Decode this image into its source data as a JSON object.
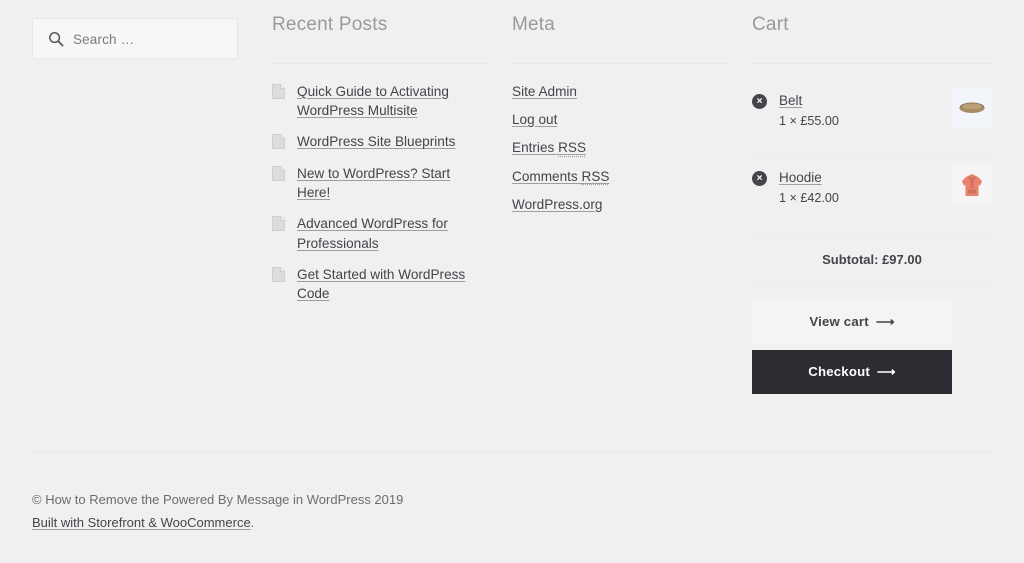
{
  "theme": {
    "page_bg": "#f0f0f0",
    "text_color": "#43454b",
    "muted_color": "#9a9a9a",
    "divider_color": "#e7e7e7",
    "checkout_bg": "#2c2d33",
    "view_cart_bg": "#f4f4f4"
  },
  "search": {
    "placeholder": "Search …",
    "value": "",
    "icon": "search-icon"
  },
  "recent_posts": {
    "title": "Recent Posts",
    "items": [
      {
        "label": "Quick Guide to Activating WordPress Multisite",
        "icon": "document-icon"
      },
      {
        "label": "WordPress Site Blueprints",
        "icon": "document-icon"
      },
      {
        "label": "New to WordPress? Start Here!",
        "icon": "document-icon"
      },
      {
        "label": "Advanced WordPress for Professionals",
        "icon": "document-icon"
      },
      {
        "label": "Get Started with WordPress Code",
        "icon": "document-icon"
      }
    ]
  },
  "meta": {
    "title": "Meta",
    "items": [
      {
        "label": "Site Admin",
        "abbr": ""
      },
      {
        "label": "Log out",
        "abbr": ""
      },
      {
        "label": "Entries ",
        "abbr": "RSS"
      },
      {
        "label": "Comments ",
        "abbr": "RSS"
      },
      {
        "label": "WordPress.org",
        "abbr": ""
      }
    ]
  },
  "cart": {
    "title": "Cart",
    "remove_icon": "remove-circle-icon",
    "items": [
      {
        "name": "Belt",
        "quantity_line": "1 × £55.00",
        "remove_label": "×",
        "thumb": "belt-thumbnail"
      },
      {
        "name": "Hoodie",
        "quantity_line": "1 × £42.00",
        "remove_label": "×",
        "thumb": "hoodie-thumbnail"
      }
    ],
    "subtotal": "Subtotal: £97.00",
    "view_cart_label": "View cart",
    "checkout_label": "Checkout",
    "arrow_glyph": "⟶"
  },
  "footer": {
    "copyright": "© How to Remove the Powered By Message in WordPress 2019",
    "built_with_link": "Built with Storefront & WooCommerce",
    "built_with_suffix": "."
  }
}
